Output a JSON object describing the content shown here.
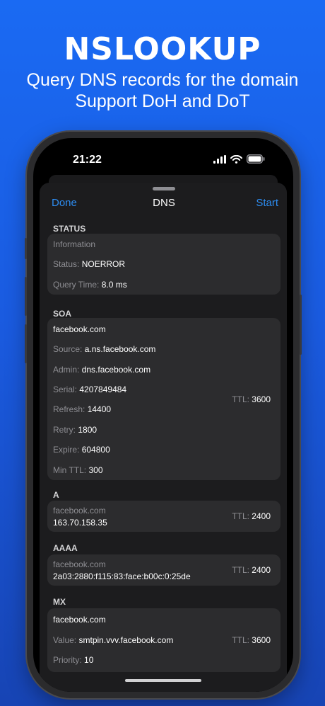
{
  "promo": {
    "title": "NSLOOKUP",
    "subtitle_line1": "Query DNS records for the domain",
    "subtitle_line2": "Support DoH and DoT"
  },
  "status_bar": {
    "time": "21:22"
  },
  "nav": {
    "done": "Done",
    "title": "DNS",
    "start": "Start"
  },
  "sections": {
    "status": {
      "header": "STATUS",
      "info": "Information",
      "status_label": "Status:",
      "status_value": "NOERROR",
      "query_label": "Query Time:",
      "query_value": "8.0 ms"
    },
    "soa": {
      "header": "SOA",
      "domain": "facebook.com",
      "source_label": "Source:",
      "source_value": "a.ns.facebook.com",
      "admin_label": "Admin:",
      "admin_value": "dns.facebook.com",
      "serial_label": "Serial:",
      "serial_value": "4207849484",
      "refresh_label": "Refresh:",
      "refresh_value": "14400",
      "retry_label": "Retry:",
      "retry_value": "1800",
      "expire_label": "Expire:",
      "expire_value": "604800",
      "minttl_label": "Min TTL:",
      "minttl_value": "300",
      "ttl_label": "TTL:",
      "ttl_value": "3600"
    },
    "a": {
      "header": "A",
      "domain": "facebook.com",
      "value": "163.70.158.35",
      "ttl_label": "TTL:",
      "ttl_value": "2400"
    },
    "aaaa": {
      "header": "AAAA",
      "domain": "facebook.com",
      "value": "2a03:2880:f115:83:face:b00c:0:25de",
      "ttl_label": "TTL:",
      "ttl_value": "2400"
    },
    "mx": {
      "header": "MX",
      "domain": "facebook.com",
      "value_label": "Value:",
      "value_value": "smtpin.vvv.facebook.com",
      "priority_label": "Priority:",
      "priority_value": "10",
      "ttl_label": "TTL:",
      "ttl_value": "3600"
    }
  },
  "colors": {
    "accent": "#2d8cf0",
    "background": "#1a5be0",
    "card": "#2c2c2e",
    "sheet": "#1c1c1e"
  },
  "icons": [
    "signal-icon",
    "wifi-icon",
    "battery-icon"
  ]
}
